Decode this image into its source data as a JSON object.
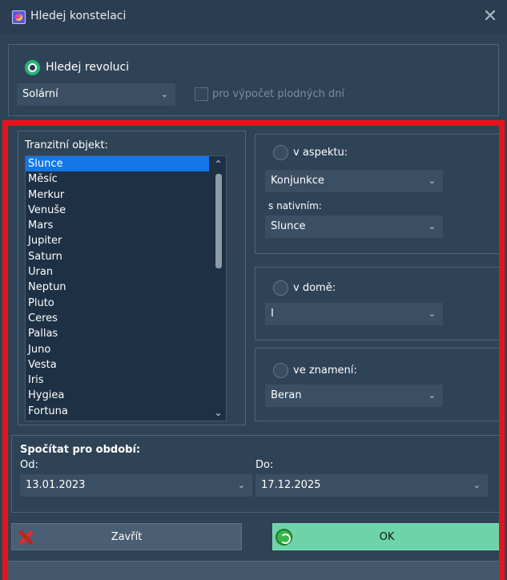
{
  "window": {
    "title": "Hledej konstelaci",
    "close_glyph": "✕"
  },
  "revolution": {
    "radio_label": "Hledej revoluci",
    "type_value": "Solární",
    "fertile_label": "pro výpočet plodných dní"
  },
  "transit": {
    "label": "Tranzitní objekt:",
    "items": [
      "Slunce",
      "Měsíc",
      "Merkur",
      "Venuše",
      "Mars",
      "Jupiter",
      "Saturn",
      "Uran",
      "Neptun",
      "Pluto",
      "Ceres",
      "Pallas",
      "Juno",
      "Vesta",
      "Iris",
      "Hygiea",
      "Fortuna"
    ],
    "selected_index": 0
  },
  "aspect": {
    "radio_label": "v aspektu:",
    "aspect_value": "Konjunkce",
    "natal_label": "s nativním:",
    "natal_value": "Slunce"
  },
  "house": {
    "radio_label": "v domě:",
    "value": "I"
  },
  "sign": {
    "radio_label": "ve znamení:",
    "value": "Beran"
  },
  "period": {
    "title": "Spočítat pro období:",
    "from_label": "Od:",
    "from_value": "13.01.2023",
    "to_label": "Do:",
    "to_value": "17.12.2025"
  },
  "buttons": {
    "close_label": "Zavřít",
    "ok_label": "OK"
  },
  "icons": {
    "chevron": "chevron-down-icon",
    "close": "close-icon",
    "ok": "ok-icon"
  },
  "colors": {
    "highlight": "#e5141c",
    "selection": "#1377e8",
    "ok_button": "#6fd3aa"
  }
}
